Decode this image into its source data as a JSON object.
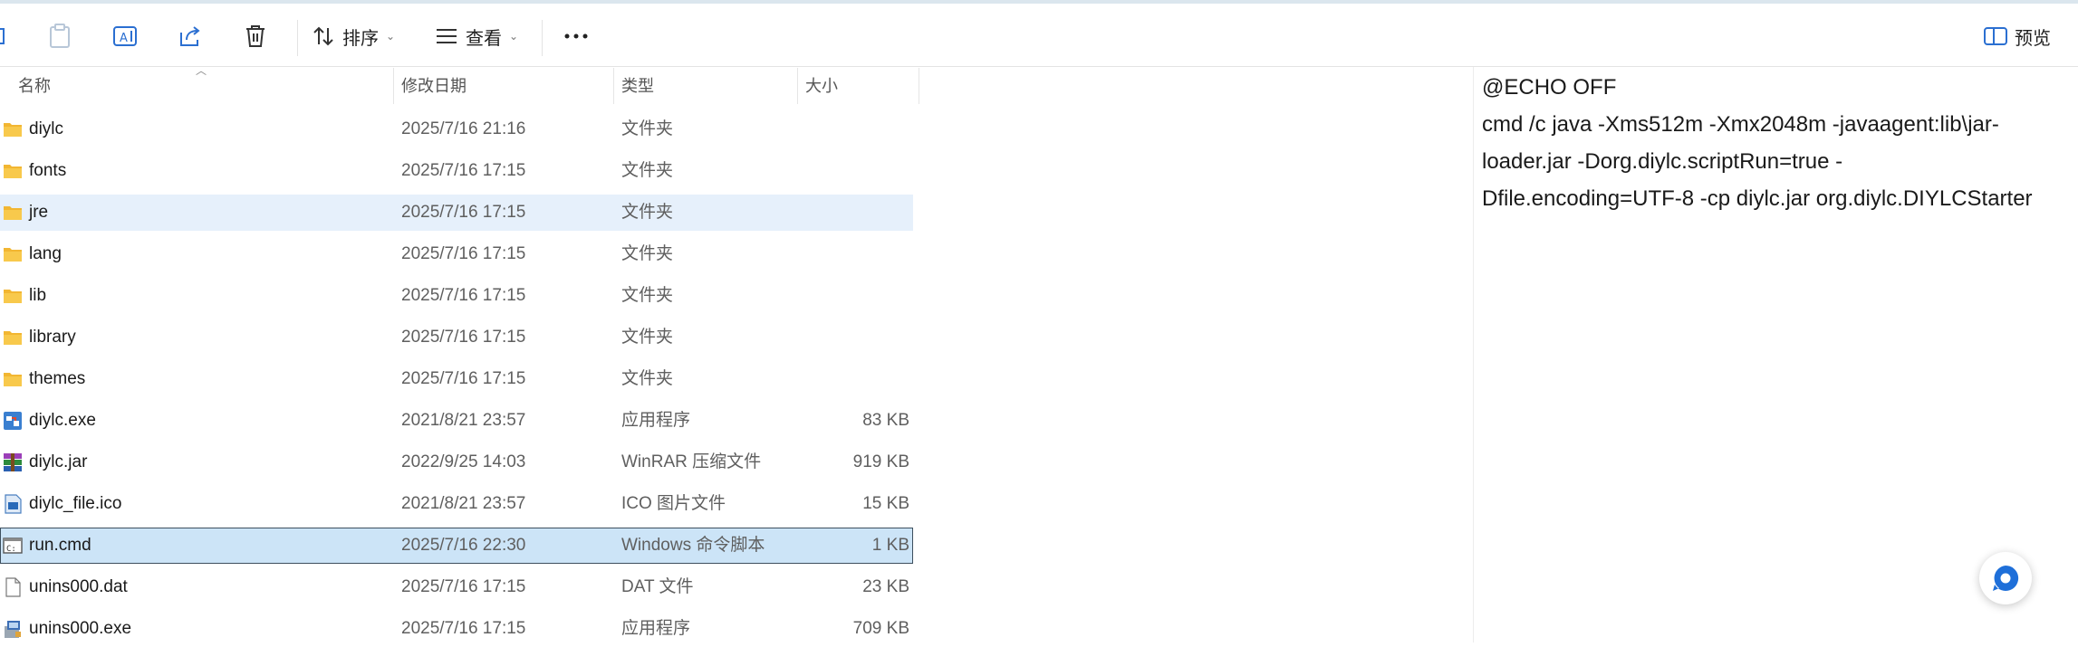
{
  "toolbar": {
    "sort_label": "排序",
    "view_label": "查看",
    "more_label": "···",
    "preview_label": "预览",
    "icons": [
      "partial-left-icon",
      "paste-icon",
      "rename-icon",
      "share-icon",
      "delete-icon",
      "sort-icon",
      "view-icon",
      "more-icon",
      "preview-pane-icon"
    ]
  },
  "columns": {
    "name": "名称",
    "date": "修改日期",
    "type": "类型",
    "size": "大小"
  },
  "files": [
    {
      "name": "diylc",
      "date": "2025/7/16 21:16",
      "type": "文件夹",
      "size": "",
      "icon": "folder-icon"
    },
    {
      "name": "fonts",
      "date": "2025/7/16 17:15",
      "type": "文件夹",
      "size": "",
      "icon": "folder-icon"
    },
    {
      "name": "jre",
      "date": "2025/7/16 17:15",
      "type": "文件夹",
      "size": "",
      "icon": "folder-icon"
    },
    {
      "name": "lang",
      "date": "2025/7/16 17:15",
      "type": "文件夹",
      "size": "",
      "icon": "folder-icon"
    },
    {
      "name": "lib",
      "date": "2025/7/16 17:15",
      "type": "文件夹",
      "size": "",
      "icon": "folder-icon"
    },
    {
      "name": "library",
      "date": "2025/7/16 17:15",
      "type": "文件夹",
      "size": "",
      "icon": "folder-icon"
    },
    {
      "name": "themes",
      "date": "2025/7/16 17:15",
      "type": "文件夹",
      "size": "",
      "icon": "folder-icon"
    },
    {
      "name": "diylc.exe",
      "date": "2021/8/21 23:57",
      "type": "应用程序",
      "size": "83 KB",
      "icon": "app-icon"
    },
    {
      "name": "diylc.jar",
      "date": "2022/9/25 14:03",
      "type": "WinRAR 压缩文件",
      "size": "919 KB",
      "icon": "archive-icon"
    },
    {
      "name": "diylc_file.ico",
      "date": "2021/8/21 23:57",
      "type": "ICO 图片文件",
      "size": "15 KB",
      "icon": "image-icon"
    },
    {
      "name": "run.cmd",
      "date": "2025/7/16 22:30",
      "type": "Windows 命令脚本",
      "size": "1 KB",
      "icon": "script-icon"
    },
    {
      "name": "unins000.dat",
      "date": "2025/7/16 17:15",
      "type": "DAT 文件",
      "size": "23 KB",
      "icon": "file-icon"
    },
    {
      "name": "unins000.exe",
      "date": "2025/7/16 17:15",
      "type": "应用程序",
      "size": "709 KB",
      "icon": "installer-icon"
    }
  ],
  "preview": {
    "lines": [
      "@ECHO OFF",
      "cmd /c java -Xms512m -Xmx2048m -javaagent:lib\\jar-",
      "loader.jar -Dorg.diylc.scriptRun=true -",
      "Dfile.encoding=UTF-8 -cp diylc.jar org.diylc.DIYLCStarter"
    ]
  },
  "colors": {
    "selection_light": "#e6f0fb",
    "selection_dark": "#cce4f7",
    "folder": "#f8c94c",
    "accent": "#1e6fd9"
  }
}
